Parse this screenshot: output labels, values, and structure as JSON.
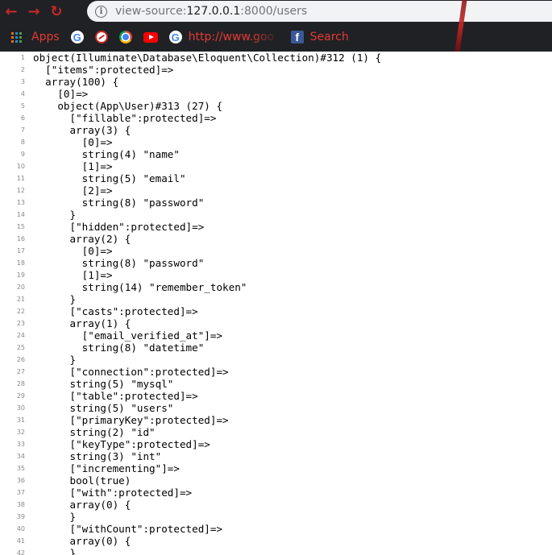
{
  "browser": {
    "toolbar": {
      "back_icon": "back-arrow-icon",
      "forward_icon": "forward-arrow-icon",
      "reload_icon": "reload-icon",
      "info_glyph": "i",
      "url_prefix": "view-source:",
      "url_host": "127.0.0.1",
      "url_path": ":8000/users"
    },
    "bookmarks": [
      {
        "label": "Apps",
        "icon": "apps-grid-icon"
      },
      {
        "label": "",
        "icon": "google-icon"
      },
      {
        "label": "",
        "icon": "wordpress-settings-icon"
      },
      {
        "label": "",
        "icon": "chrome-icon"
      },
      {
        "label": "",
        "icon": "youtube-icon"
      },
      {
        "label": "http://www.goo",
        "icon": "google-icon"
      },
      {
        "label": "Search",
        "icon": "facebook-icon"
      }
    ],
    "accent_color": "#e53935"
  },
  "source": {
    "lines": [
      {
        "n": "1",
        "text": "object(Illuminate\\Database\\Eloquent\\Collection)#312 (1) {"
      },
      {
        "n": "2",
        "text": "  [\"items\":protected]=>"
      },
      {
        "n": "3",
        "text": "  array(100) {"
      },
      {
        "n": "4",
        "text": "    [0]=>"
      },
      {
        "n": "5",
        "text": "    object(App\\User)#313 (27) {"
      },
      {
        "n": "6",
        "text": "      [\"fillable\":protected]=>"
      },
      {
        "n": "7",
        "text": "      array(3) {"
      },
      {
        "n": "8",
        "text": "        [0]=>"
      },
      {
        "n": "9",
        "text": "        string(4) \"name\""
      },
      {
        "n": "10",
        "text": "        [1]=>"
      },
      {
        "n": "11",
        "text": "        string(5) \"email\""
      },
      {
        "n": "12",
        "text": "        [2]=>"
      },
      {
        "n": "13",
        "text": "        string(8) \"password\""
      },
      {
        "n": "14",
        "text": "      }"
      },
      {
        "n": "15",
        "text": "      [\"hidden\":protected]=>"
      },
      {
        "n": "16",
        "text": "      array(2) {"
      },
      {
        "n": "17",
        "text": "        [0]=>"
      },
      {
        "n": "18",
        "text": "        string(8) \"password\""
      },
      {
        "n": "19",
        "text": "        [1]=>"
      },
      {
        "n": "20",
        "text": "        string(14) \"remember_token\""
      },
      {
        "n": "21",
        "text": "      }"
      },
      {
        "n": "22",
        "text": "      [\"casts\":protected]=>"
      },
      {
        "n": "23",
        "text": "      array(1) {"
      },
      {
        "n": "24",
        "text": "        [\"email_verified_at\"]=>"
      },
      {
        "n": "25",
        "text": "        string(8) \"datetime\""
      },
      {
        "n": "26",
        "text": "      }"
      },
      {
        "n": "27",
        "text": "      [\"connection\":protected]=>"
      },
      {
        "n": "28",
        "text": "      string(5) \"mysql\""
      },
      {
        "n": "29",
        "text": "      [\"table\":protected]=>"
      },
      {
        "n": "30",
        "text": "      string(5) \"users\""
      },
      {
        "n": "31",
        "text": "      [\"primaryKey\":protected]=>"
      },
      {
        "n": "32",
        "text": "      string(2) \"id\""
      },
      {
        "n": "33",
        "text": "      [\"keyType\":protected]=>"
      },
      {
        "n": "34",
        "text": "      string(3) \"int\""
      },
      {
        "n": "35",
        "text": "      [\"incrementing\"]=>"
      },
      {
        "n": "36",
        "text": "      bool(true)"
      },
      {
        "n": "37",
        "text": "      [\"with\":protected]=>"
      },
      {
        "n": "38",
        "text": "      array(0) {"
      },
      {
        "n": "39",
        "text": "      }"
      },
      {
        "n": "40",
        "text": "      [\"withCount\":protected]=>"
      },
      {
        "n": "41",
        "text": "      array(0) {"
      },
      {
        "n": "42",
        "text": "      }"
      }
    ]
  }
}
